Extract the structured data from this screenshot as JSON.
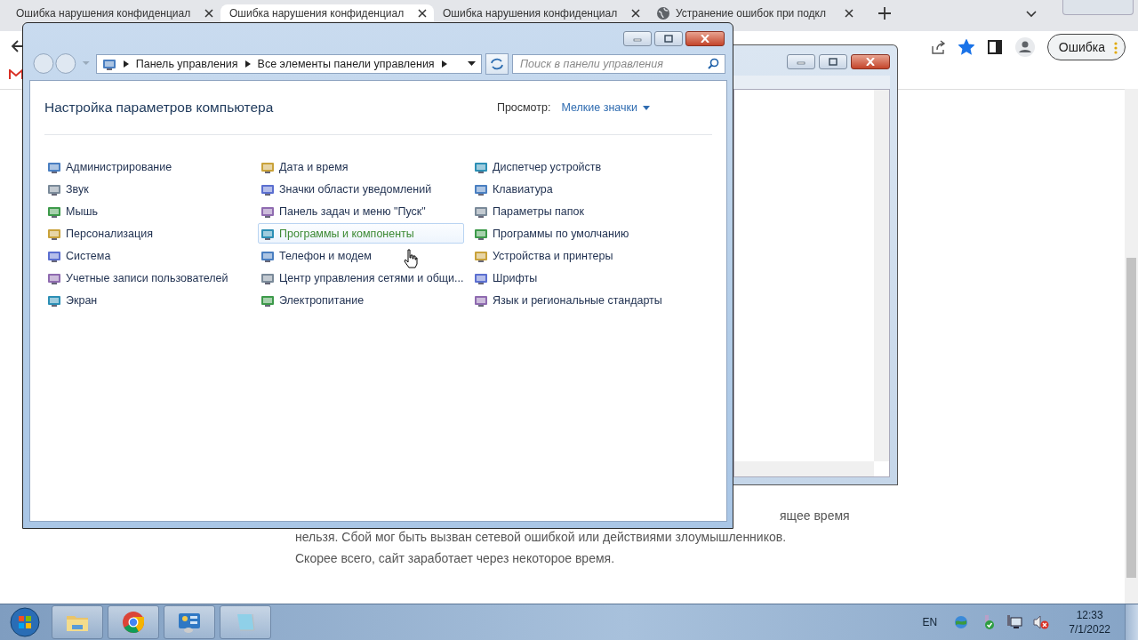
{
  "browser": {
    "tabs": [
      {
        "title": "Ошибка нарушения конфиденциал",
        "selected": false,
        "kind": "plain"
      },
      {
        "title": "Ошибка нарушения конфиденциал",
        "selected": true,
        "kind": "plain"
      },
      {
        "title": "Ошибка нарушения конфиденциал",
        "selected": false,
        "kind": "plain"
      },
      {
        "title": "Устранение ошибок при подкл",
        "selected": false,
        "kind": "globe"
      }
    ],
    "bookmarked": true,
    "profile_button": "Ошибка",
    "page_lines": [
      "ящее время",
      "нельзя. Сбой мог быть вызван сетевой ошибкой или действиями злоумышленников.",
      "Скорее всего, сайт заработает через некоторое время."
    ]
  },
  "control_panel": {
    "breadcrumbs": [
      "Панель управления",
      "Все элементы панели управления"
    ],
    "search": {
      "placeholder": "Поиск в панели управления"
    },
    "heading": "Настройка параметров компьютера",
    "view_label": "Просмотр:",
    "view_value": "Мелкие значки",
    "columns": [
      {
        "items": [
          {
            "label": "Администрирование",
            "hovered": false
          },
          {
            "label": "Звук",
            "hovered": false
          },
          {
            "label": "Мышь",
            "hovered": false
          },
          {
            "label": "Персонализация",
            "hovered": false
          },
          {
            "label": "Система",
            "hovered": false
          },
          {
            "label": "Учетные записи пользователей",
            "hovered": false
          },
          {
            "label": "Экран",
            "hovered": false
          }
        ]
      },
      {
        "items": [
          {
            "label": "Дата и время",
            "hovered": false
          },
          {
            "label": "Значки области уведомлений",
            "hovered": false
          },
          {
            "label": "Панель задач и меню \"Пуск\"",
            "hovered": false
          },
          {
            "label": "Программы и компоненты",
            "hovered": true
          },
          {
            "label": "Телефон и модем",
            "hovered": false
          },
          {
            "label": "Центр управления сетями и общи...",
            "hovered": false
          },
          {
            "label": "Электропитание",
            "hovered": false
          }
        ]
      },
      {
        "items": [
          {
            "label": "Диспетчер устройств",
            "hovered": false
          },
          {
            "label": "Клавиатура",
            "hovered": false
          },
          {
            "label": "Параметры папок",
            "hovered": false
          },
          {
            "label": "Программы по умолчанию",
            "hovered": false
          },
          {
            "label": "Устройства и принтеры",
            "hovered": false
          },
          {
            "label": "Шрифты",
            "hovered": false
          },
          {
            "label": "Язык и региональные стандарты",
            "hovered": false
          }
        ]
      }
    ]
  },
  "taskbar": {
    "apps": [
      {
        "kind": "explorer"
      },
      {
        "kind": "chrome"
      },
      {
        "kind": "control"
      },
      {
        "kind": "notepad"
      }
    ],
    "tray": {
      "language": "EN",
      "time": "12:33",
      "date": "7/1/2022"
    }
  }
}
